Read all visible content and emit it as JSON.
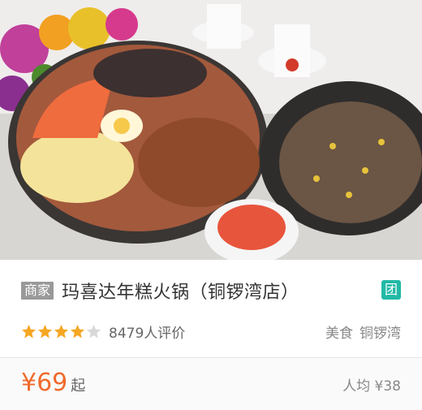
{
  "photo": {
    "alt": "food-photo"
  },
  "listing": {
    "merchant_tag": "商家",
    "title": "玛喜达年糕火锅（铜锣湾店）",
    "tuan_badge": "团",
    "rating_stars": 4,
    "review_count": "8479人评价",
    "category": "美食",
    "district": "铜锣湾"
  },
  "price": {
    "value": "¥69",
    "suffix": "起",
    "avg_label": "人均 ¥38"
  },
  "colors": {
    "price": "#f06a2c",
    "star": "#f5a623",
    "tuan": "#22b9a6"
  }
}
